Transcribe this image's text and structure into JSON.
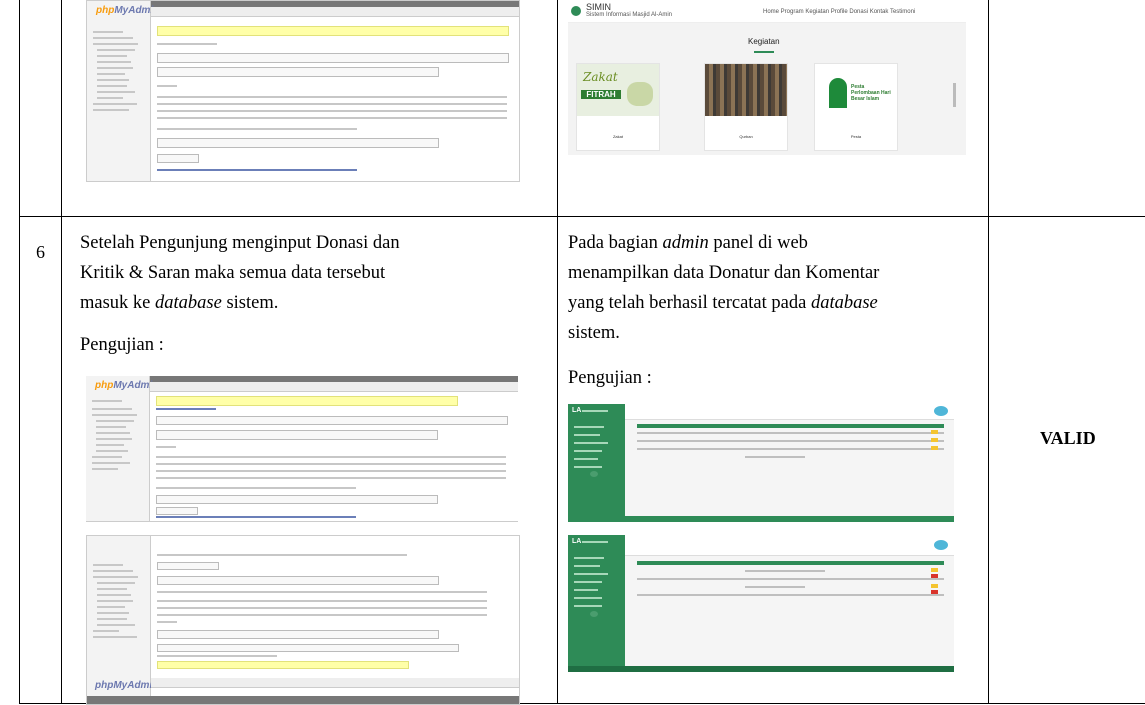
{
  "row_number": "6",
  "left": {
    "para_1": "Setelah Pengunjung menginput Donasi dan",
    "para_2": "Kritik & Saran maka semua data tersebut",
    "para_3a": "masuk ke ",
    "para_3b": "database",
    "para_3c": " sistem.",
    "test_label": "Pengujian :"
  },
  "right": {
    "para_1a": "Pada bagian ",
    "para_1b": "admin",
    "para_1c": " panel di web",
    "para_2": "menampilkan data Donatur dan Komentar",
    "para_3a": "yang telah berhasil tercatat pada ",
    "para_3b": "database",
    "para_4": "sistem.",
    "test_label": "Pengujian :"
  },
  "result": "VALID",
  "thumbnails": {
    "pma_logo_a": "php",
    "pma_logo_b": "MyAdmin",
    "site_title": "SIMIN",
    "site_subtitle": "Sistem Informasi Masjid Al-Amin",
    "site_nav": "Home   Program   Kegiatan   Profile   Donasi   Kontak   Testimoni",
    "section_title": "Kegiatan",
    "cards": [
      "Zakat",
      "Qurban",
      "Pesta"
    ],
    "zakat_word": "Zakat",
    "fitrah_word": "FITRAH",
    "pesta_words": "Pesta Perlombaan Hari Besar Islam",
    "admin_brand": "LA",
    "bottom_logo": "phpMyAdmin"
  },
  "colors": {
    "admin_green": "#2e8b57",
    "pma_blue": "#6c78af",
    "pma_orange": "#f89c0e"
  }
}
